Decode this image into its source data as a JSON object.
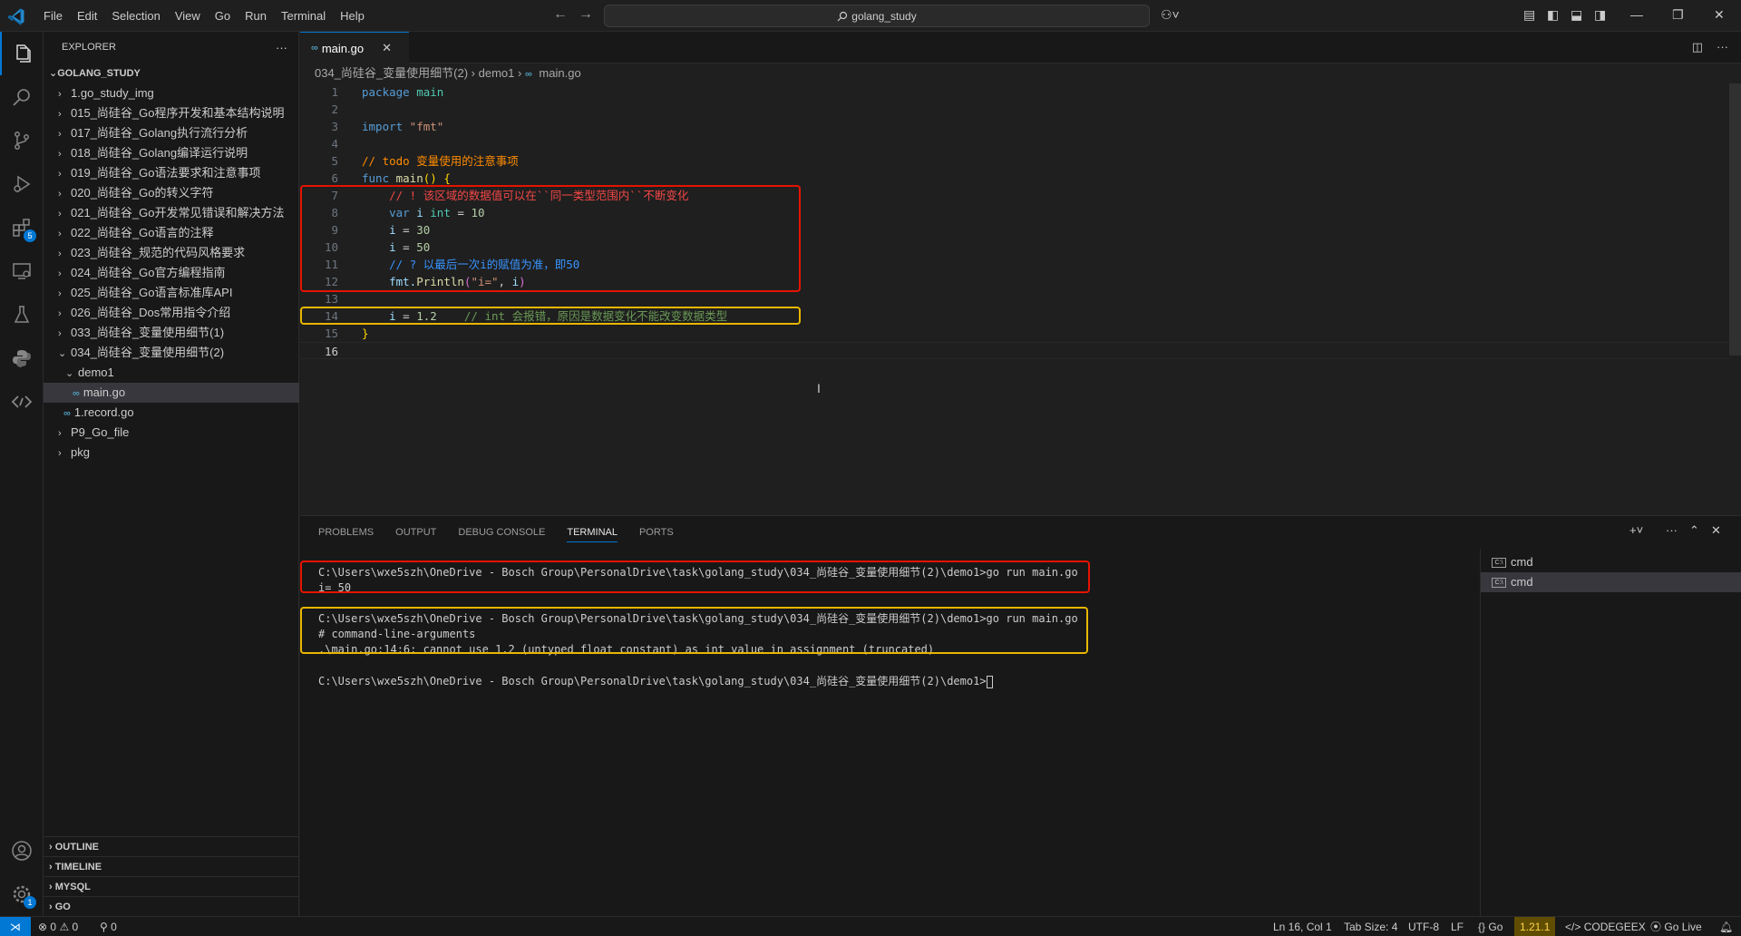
{
  "menu": [
    "File",
    "Edit",
    "Selection",
    "View",
    "Go",
    "Run",
    "Terminal",
    "Help"
  ],
  "search": {
    "text": "golang_study"
  },
  "explorer": {
    "title": "EXPLORER",
    "root": "GOLANG_STUDY",
    "items": [
      {
        "label": "1.go_study_img"
      },
      {
        "label": "015_尚硅谷_Go程序开发和基本结构说明"
      },
      {
        "label": "017_尚硅谷_Golang执行流行分析"
      },
      {
        "label": "018_尚硅谷_Golang编译运行说明"
      },
      {
        "label": "019_尚硅谷_Go语法要求和注意事项"
      },
      {
        "label": "020_尚硅谷_Go的转义字符"
      },
      {
        "label": "021_尚硅谷_Go开发常见错误和解决方法"
      },
      {
        "label": "022_尚硅谷_Go语言的注释"
      },
      {
        "label": "023_尚硅谷_规范的代码风格要求"
      },
      {
        "label": "024_尚硅谷_Go官方编程指南"
      },
      {
        "label": "025_尚硅谷_Go语言标准库API"
      },
      {
        "label": "026_尚硅谷_Dos常用指令介绍"
      },
      {
        "label": "033_尚硅谷_变量使用细节(1)"
      },
      {
        "label": "034_尚硅谷_变量使用细节(2)"
      },
      {
        "label": "demo1"
      },
      {
        "label": "main.go"
      },
      {
        "label": "1.record.go"
      },
      {
        "label": "P9_Go_file"
      },
      {
        "label": "pkg"
      }
    ],
    "sections": [
      "OUTLINE",
      "TIMELINE",
      "MYSQL",
      "GO"
    ]
  },
  "activity": {
    "extensions_badge": "5",
    "settings_badge": "1"
  },
  "editor": {
    "tab": "main.go",
    "breadcrumb": [
      "034_尚硅谷_变量使用细节(2)",
      "demo1",
      "main.go"
    ],
    "lines": {
      "l1a": "package",
      "l1b": " main",
      "l3a": "import",
      "l3b": " \"fmt\"",
      "l5": "// todo 变量使用的注意事项",
      "l6a": "func",
      "l6b": " main",
      "l6c": "() {",
      "l7": "    // ! 该区域的数据值可以在``同一类型范围内``不断变化",
      "l8a": "    var",
      "l8b": " i",
      "l8c": " int",
      "l8d": " = ",
      "l8e": "10",
      "l9a": "    i",
      "l9b": " = ",
      "l9c": "30",
      "l10a": "    i",
      "l10b": " = ",
      "l10c": "50",
      "l11": "    // ? 以最后一次i的赋值为准，即50",
      "l12a": "    fmt.",
      "l12b": "Println",
      "l12c": "(",
      "l12d": "\"i=\"",
      "l12e": ", ",
      "l12f": "i",
      "l12g": ")",
      "l14a": "    i",
      "l14b": " = ",
      "l14c": "1.2",
      "l14d": "    // int 会报错，原因是数据变化不能改变数据类型",
      "l15": "}"
    }
  },
  "panel": {
    "tabs": [
      "PROBLEMS",
      "OUTPUT",
      "DEBUG CONSOLE",
      "TERMINAL",
      "PORTS"
    ],
    "terminal": [
      "C:\\Users\\wxe5szh\\OneDrive - Bosch Group\\PersonalDrive\\task\\golang_study\\034_尚硅谷_变量使用细节(2)\\demo1>go run main.go",
      "i= 50",
      "C:\\Users\\wxe5szh\\OneDrive - Bosch Group\\PersonalDrive\\task\\golang_study\\034_尚硅谷_变量使用细节(2)\\demo1>go run main.go",
      "# command-line-arguments",
      ".\\main.go:14:6: cannot use 1.2 (untyped float constant) as int value in assignment (truncated)",
      "C:\\Users\\wxe5szh\\OneDrive - Bosch Group\\PersonalDrive\\task\\golang_study\\034_尚硅谷_变量使用细节(2)\\demo1>"
    ],
    "term_list": [
      "cmd",
      "cmd"
    ]
  },
  "status": {
    "errors": "0",
    "warnings": "0",
    "ports": "0",
    "position": "Ln 16, Col 1",
    "tabsize": "Tab Size: 4",
    "encoding": "UTF-8",
    "eol": "LF",
    "language": "Go",
    "version": "1.21.1",
    "codegeex": "CODEGEEX",
    "golive": "Go Live"
  },
  "colors": {
    "accent": "#0078d4",
    "red_box": "#e51400",
    "yellow_box": "#e9b600"
  }
}
